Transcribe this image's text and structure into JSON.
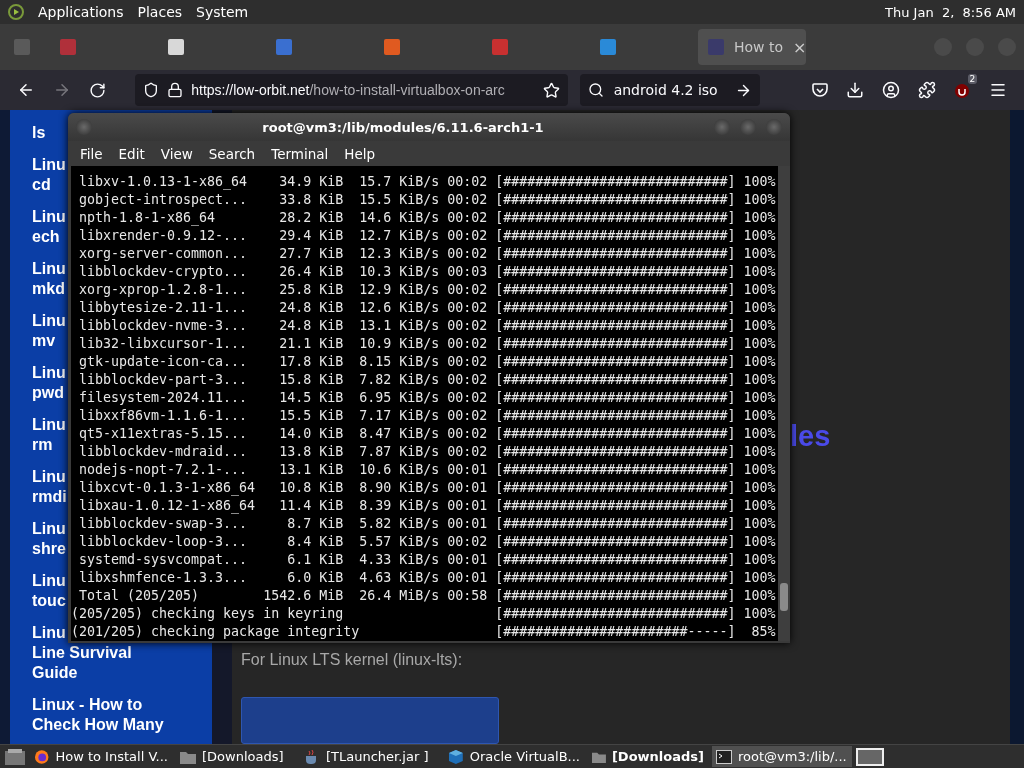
{
  "top_panel": {
    "menus": [
      "Applications",
      "Places",
      "System"
    ],
    "clock": "Thu Jan  2,  8:56 AM"
  },
  "browser": {
    "tabs": [
      {
        "selected": false,
        "color": "#5a5a5a"
      },
      {
        "selected": false,
        "color": "#b0303a"
      },
      {
        "selected": false,
        "color": "#d8d8d8"
      },
      {
        "selected": false,
        "color": "#3a6fd0"
      },
      {
        "selected": false,
        "color": "#e05a20"
      },
      {
        "selected": false,
        "color": "#c83030"
      },
      {
        "selected": false,
        "color": "#2a8ad8"
      },
      {
        "selected": true,
        "color": "#3a3a6a",
        "label": "How to",
        "close": "×"
      }
    ],
    "url": {
      "origin": "https://low-orbit.net",
      "path": "/how-to-install-virtualbox-on-arc"
    },
    "search": {
      "value": "android 4.2 iso"
    },
    "extension_badge": "2",
    "sidebar": [
      [
        "ls"
      ],
      [
        "Linu",
        "cd"
      ],
      [
        "Linu",
        "ech"
      ],
      [
        "Linu",
        "mkd"
      ],
      [
        "Linu",
        "mv"
      ],
      [
        "Linu",
        "pwd"
      ],
      [
        "Linu",
        "rm"
      ],
      [
        "Linu",
        "rmdi"
      ],
      [
        "Linu",
        "shre"
      ],
      [
        "Linu",
        "touc"
      ],
      [
        "Linu",
        "Line Survival",
        "Guide"
      ],
      [
        "Linux - How to",
        "Check How Many"
      ]
    ],
    "heading_fragment": "les",
    "paragraph": "For Linux LTS kernel (linux-lts):"
  },
  "terminal": {
    "title": "root@vm3:/lib/modules/6.11.6-arch1-1",
    "menus": [
      "File",
      "Edit",
      "View",
      "Search",
      "Terminal",
      "Help"
    ],
    "lines": [
      {
        "kind": "download",
        "name": "libxv-1.0.13-1-x86_64",
        "size": "34.9 KiB",
        "speed": "15.7 KiB/s",
        "time": "00:02",
        "bar": "[############################]",
        "percent": "100%"
      },
      {
        "kind": "download",
        "name": "gobject-introspect...",
        "size": "33.8 KiB",
        "speed": "15.5 KiB/s",
        "time": "00:02",
        "bar": "[############################]",
        "percent": "100%"
      },
      {
        "kind": "download",
        "name": "npth-1.8-1-x86_64",
        "size": "28.2 KiB",
        "speed": "14.6 KiB/s",
        "time": "00:02",
        "bar": "[############################]",
        "percent": "100%"
      },
      {
        "kind": "download",
        "name": "libxrender-0.9.12-...",
        "size": "29.4 KiB",
        "speed": "12.7 KiB/s",
        "time": "00:02",
        "bar": "[############################]",
        "percent": "100%"
      },
      {
        "kind": "download",
        "name": "xorg-server-common...",
        "size": "27.7 KiB",
        "speed": "12.3 KiB/s",
        "time": "00:02",
        "bar": "[############################]",
        "percent": "100%"
      },
      {
        "kind": "download",
        "name": "libblockdev-crypto...",
        "size": "26.4 KiB",
        "speed": "10.3 KiB/s",
        "time": "00:03",
        "bar": "[############################]",
        "percent": "100%"
      },
      {
        "kind": "download",
        "name": "xorg-xprop-1.2.8-1...",
        "size": "25.8 KiB",
        "speed": "12.9 KiB/s",
        "time": "00:02",
        "bar": "[############################]",
        "percent": "100%"
      },
      {
        "kind": "download",
        "name": "libbytesize-2.11-1...",
        "size": "24.8 KiB",
        "speed": "12.6 KiB/s",
        "time": "00:02",
        "bar": "[############################]",
        "percent": "100%"
      },
      {
        "kind": "download",
        "name": "libblockdev-nvme-3...",
        "size": "24.8 KiB",
        "speed": "13.1 KiB/s",
        "time": "00:02",
        "bar": "[############################]",
        "percent": "100%"
      },
      {
        "kind": "download",
        "name": "lib32-libxcursor-1...",
        "size": "21.1 KiB",
        "speed": "10.9 KiB/s",
        "time": "00:02",
        "bar": "[############################]",
        "percent": "100%"
      },
      {
        "kind": "download",
        "name": "gtk-update-icon-ca...",
        "size": "17.8 KiB",
        "speed": "8.15 KiB/s",
        "time": "00:02",
        "bar": "[############################]",
        "percent": "100%"
      },
      {
        "kind": "download",
        "name": "libblockdev-part-3...",
        "size": "15.8 KiB",
        "speed": "7.82 KiB/s",
        "time": "00:02",
        "bar": "[############################]",
        "percent": "100%"
      },
      {
        "kind": "download",
        "name": "filesystem-2024.11...",
        "size": "14.5 KiB",
        "speed": "6.95 KiB/s",
        "time": "00:02",
        "bar": "[############################]",
        "percent": "100%"
      },
      {
        "kind": "download",
        "name": "libxxf86vm-1.1.6-1...",
        "size": "15.5 KiB",
        "speed": "7.17 KiB/s",
        "time": "00:02",
        "bar": "[############################]",
        "percent": "100%"
      },
      {
        "kind": "download",
        "name": "qt5-x11extras-5.15...",
        "size": "14.0 KiB",
        "speed": "8.47 KiB/s",
        "time": "00:02",
        "bar": "[############################]",
        "percent": "100%"
      },
      {
        "kind": "download",
        "name": "libblockdev-mdraid...",
        "size": "13.8 KiB",
        "speed": "7.87 KiB/s",
        "time": "00:02",
        "bar": "[############################]",
        "percent": "100%"
      },
      {
        "kind": "download",
        "name": "nodejs-nopt-7.2.1-...",
        "size": "13.1 KiB",
        "speed": "10.6 KiB/s",
        "time": "00:01",
        "bar": "[############################]",
        "percent": "100%"
      },
      {
        "kind": "download",
        "name": "libxcvt-0.1.3-1-x86_64",
        "size": "10.8 KiB",
        "speed": "8.90 KiB/s",
        "time": "00:01",
        "bar": "[############################]",
        "percent": "100%"
      },
      {
        "kind": "download",
        "name": "libxau-1.0.12-1-x86_64",
        "size": "11.4 KiB",
        "speed": "8.39 KiB/s",
        "time": "00:01",
        "bar": "[############################]",
        "percent": "100%"
      },
      {
        "kind": "download",
        "name": "libblockdev-swap-3...",
        "size": "8.7 KiB",
        "speed": "5.82 KiB/s",
        "time": "00:01",
        "bar": "[############################]",
        "percent": "100%"
      },
      {
        "kind": "download",
        "name": "libblockdev-loop-3...",
        "size": "8.4 KiB",
        "speed": "5.57 KiB/s",
        "time": "00:02",
        "bar": "[############################]",
        "percent": "100%"
      },
      {
        "kind": "download",
        "name": "systemd-sysvcompat...",
        "size": "6.1 KiB",
        "speed": "4.33 KiB/s",
        "time": "00:01",
        "bar": "[############################]",
        "percent": "100%"
      },
      {
        "kind": "download",
        "name": "libxshmfence-1.3.3...",
        "size": "6.0 KiB",
        "speed": "4.63 KiB/s",
        "time": "00:01",
        "bar": "[############################]",
        "percent": "100%"
      },
      {
        "kind": "download",
        "name": "Total (205/205)",
        "size": "1542.6 MiB",
        "speed": "26.4 MiB/s",
        "time": "00:58",
        "bar": "[############################]",
        "percent": "100%"
      },
      {
        "kind": "check",
        "name": "(205/205) checking keys in keyring",
        "bar": "[############################]",
        "percent": "100%"
      },
      {
        "kind": "check",
        "name": "(201/205) checking package integrity",
        "bar": "[#######################-----]",
        "percent": "85%"
      }
    ]
  },
  "taskbar": [
    {
      "kind": "browser",
      "label": "How to Install V...",
      "selected": false,
      "emphasized": false
    },
    {
      "kind": "folder",
      "label": "[Downloads]",
      "selected": false,
      "emphasized": false
    },
    {
      "kind": "java",
      "label": "[TLauncher.jar ]",
      "selected": false,
      "emphasized": false
    },
    {
      "kind": "vbox",
      "label": "Oracle VirtualB...",
      "selected": false,
      "emphasized": false
    },
    {
      "kind": "folder",
      "label": "[Downloads]",
      "selected": false,
      "emphasized": true
    },
    {
      "kind": "terminal",
      "label": "root@vm3:/lib/...",
      "selected": true,
      "emphasized": false
    }
  ]
}
